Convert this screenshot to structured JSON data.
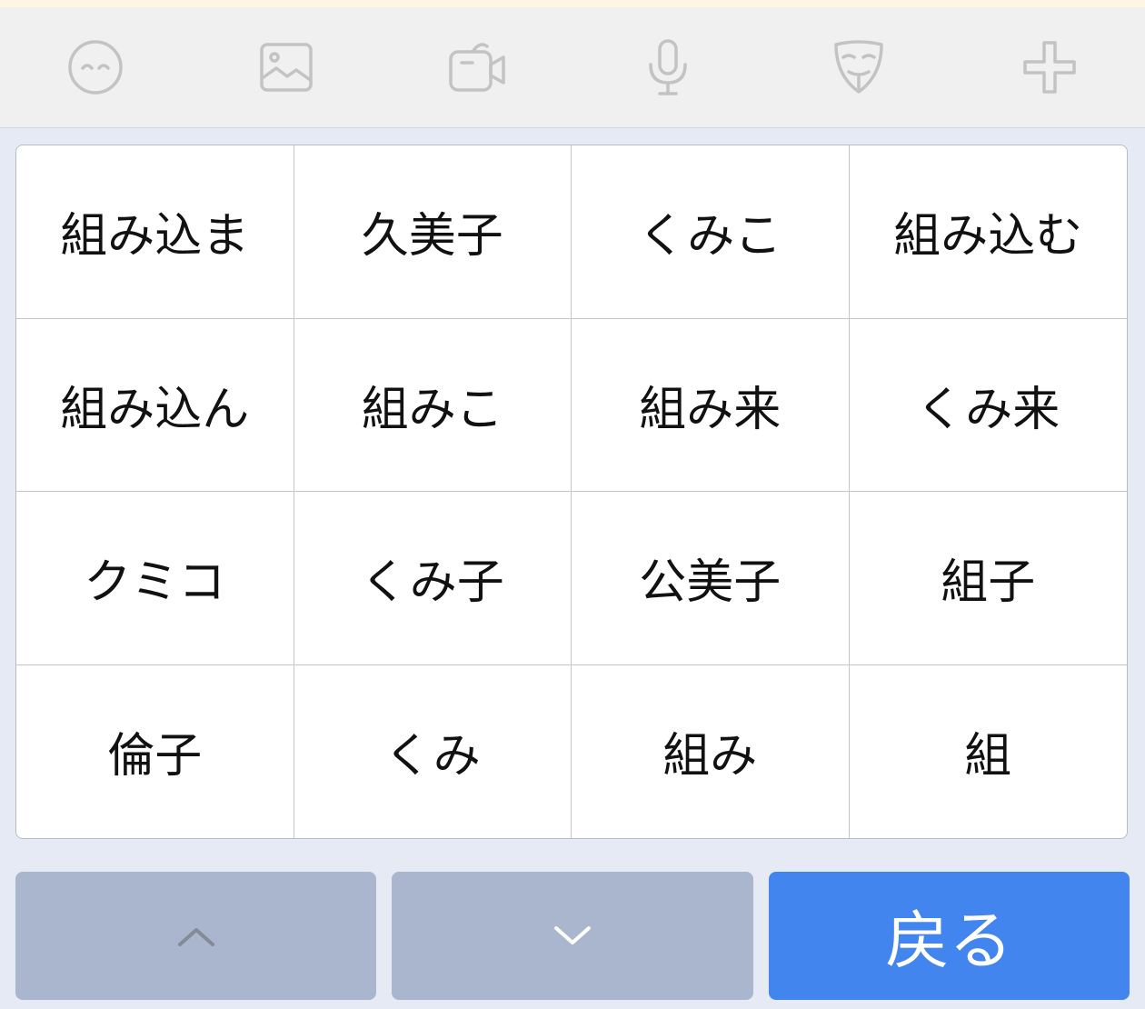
{
  "toolbar": {
    "icons": [
      "emoji-icon",
      "image-icon",
      "video-icon",
      "microphone-icon",
      "mask-icon",
      "plus-icon"
    ]
  },
  "candidates": [
    "組み込ま",
    "久美子",
    "くみこ",
    "組み込む",
    "組み込ん",
    "組みこ",
    "組み来",
    "くみ来",
    "クミコ",
    "くみ子",
    "公美子",
    "組子",
    "倫子",
    "くみ",
    "組み",
    "組"
  ],
  "bottom": {
    "back_label": "戻る"
  },
  "colors": {
    "accent": "#4285ef",
    "nav_button": "#aab6cd",
    "background": "#e6eaf4",
    "toolbar_bg": "#f0f0f0",
    "icon_gray": "#c3c3c3"
  }
}
